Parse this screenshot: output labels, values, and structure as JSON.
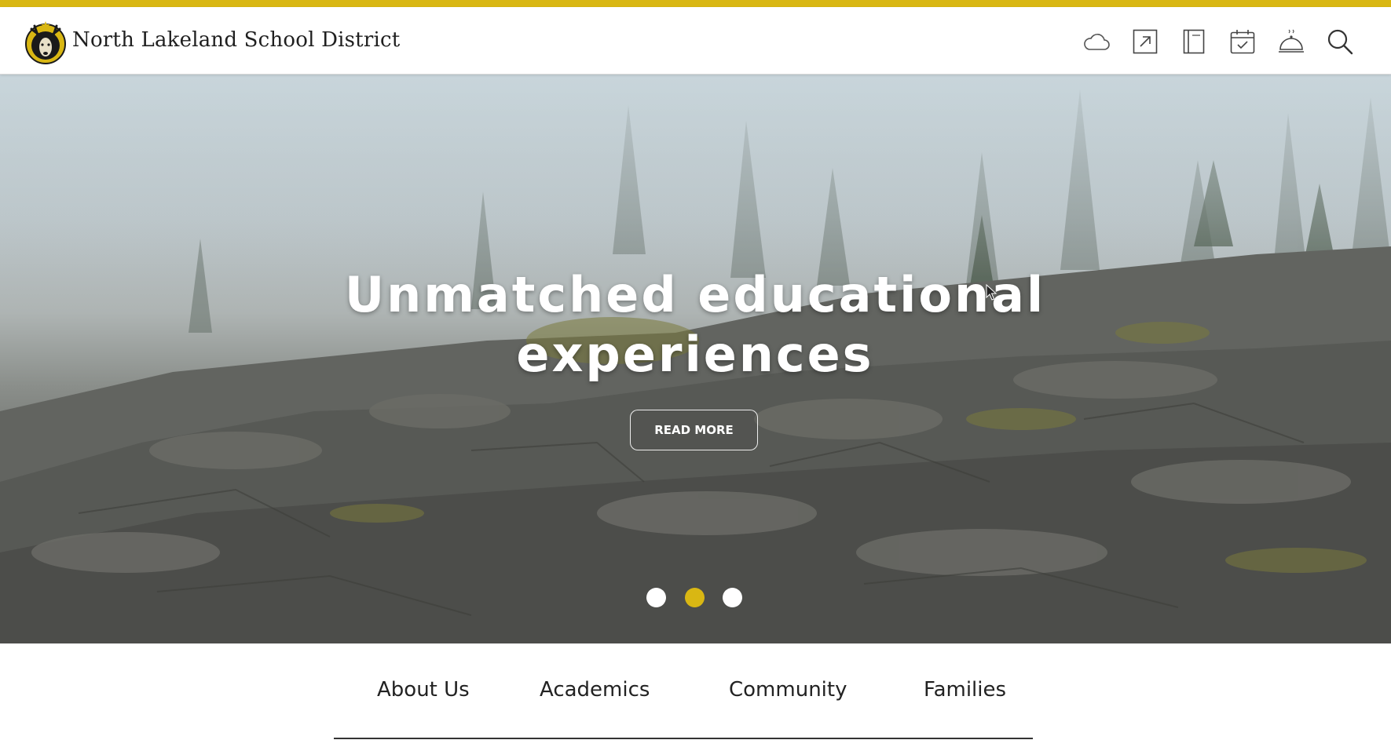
{
  "colors": {
    "accent": "#d9b713",
    "header_bg": "#ffffff",
    "text_dark": "#222222"
  },
  "header": {
    "site_title": "North Lakeland School District",
    "logo_icon": "stag-mascot-logo",
    "utility_icons": [
      "cloud-icon",
      "external-link-icon",
      "book-icon",
      "calendar-check-icon",
      "food-service-icon",
      "search-icon"
    ]
  },
  "hero": {
    "title_line1": "Unmatched educational",
    "title_line2": "experiences",
    "button_label": "READ MORE",
    "slides_total": 3,
    "active_slide": 2
  },
  "main_nav": {
    "items": [
      {
        "label": "About Us"
      },
      {
        "label": "Academics"
      },
      {
        "label": "Community"
      },
      {
        "label": "Families"
      }
    ]
  }
}
